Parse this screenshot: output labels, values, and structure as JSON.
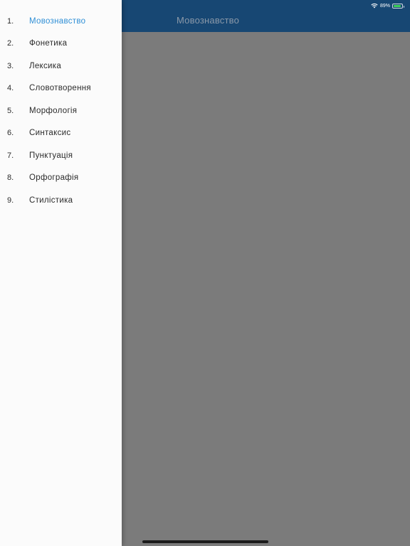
{
  "status_bar": {
    "battery_text": "89%",
    "battery_level": 0.89,
    "battery_color": "#3ccf5a"
  },
  "app_header": {
    "title": "Мовознавство",
    "background": "#174773"
  },
  "drawer": {
    "active_color": "#2f8fd6",
    "items": [
      {
        "number": "1.",
        "label": "Мовознавство",
        "active": true
      },
      {
        "number": "2.",
        "label": "Фонетика"
      },
      {
        "number": "3.",
        "label": "Лексика"
      },
      {
        "number": "4.",
        "label": "Словотворення"
      },
      {
        "number": "5.",
        "label": "Морфологія"
      },
      {
        "number": "6.",
        "label": "Синтаксис"
      },
      {
        "number": "7.",
        "label": "Пунктуація"
      },
      {
        "number": "8.",
        "label": "Орфографія"
      },
      {
        "number": "9.",
        "label": "Стилістика"
      }
    ]
  }
}
